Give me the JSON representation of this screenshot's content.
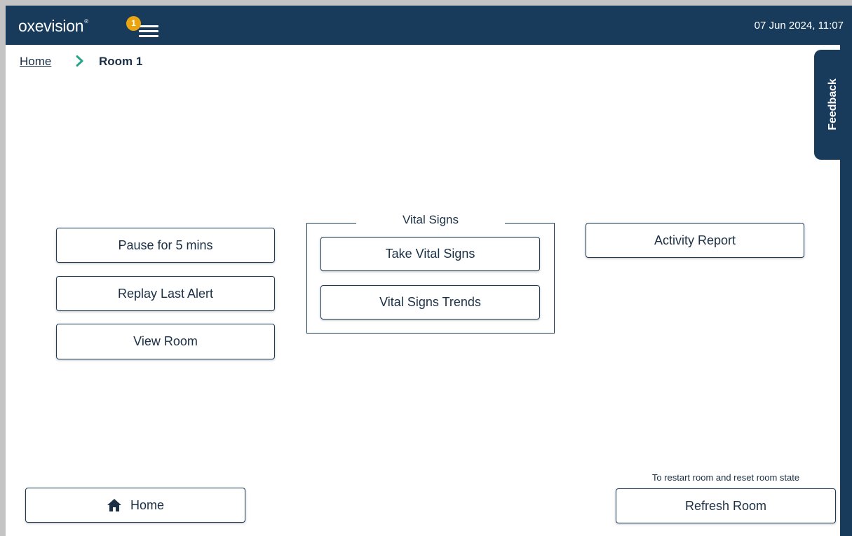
{
  "header": {
    "logo_text": "oxevision",
    "logo_mark": "®",
    "notification_count": "1",
    "menu_icon": "hamburger-menu-icon",
    "datetime": "07 Jun 2024, 11:07"
  },
  "breadcrumb": {
    "home_label": "Home",
    "separator_icon": "chevron-right-icon",
    "current": "Room 1"
  },
  "feedback": {
    "label": "Feedback"
  },
  "left_actions": {
    "pause": "Pause for 5 mins",
    "replay": "Replay Last Alert",
    "view_room": "View Room"
  },
  "vital_signs": {
    "group_label": "Vital Signs",
    "take": "Take Vital Signs",
    "trends": "Vital Signs Trends"
  },
  "right_actions": {
    "activity_report": "Activity Report"
  },
  "footer": {
    "home_label": "Home",
    "home_icon": "home-icon",
    "refresh_hint": "To restart room and reset room state",
    "refresh_label": "Refresh Room"
  },
  "colors": {
    "header_bg": "#183a5b",
    "badge": "#e9a511",
    "chevron": "#2aa58a",
    "text": "#1b2f45"
  }
}
